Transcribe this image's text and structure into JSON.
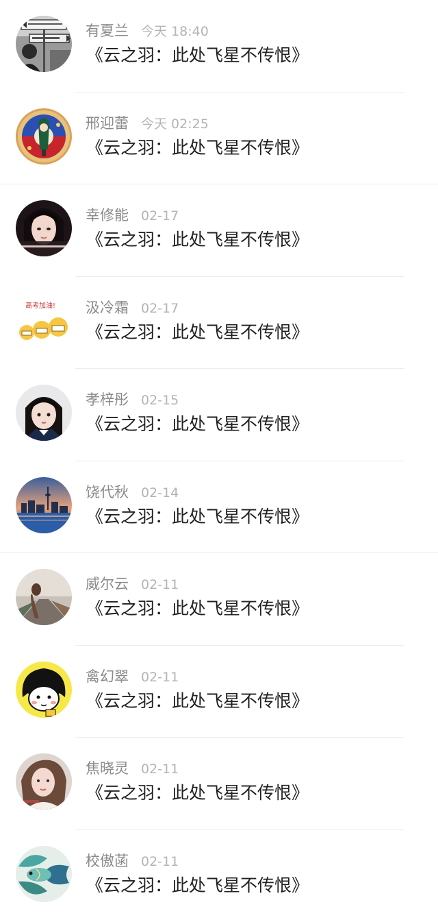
{
  "comments": [
    {
      "name": "有夏兰",
      "time": "今天 18:40",
      "title": "《云之羽：此处飞星不传恨》",
      "avatar_icon": "street-sign-photo-avatar-icon",
      "divider": "inset"
    },
    {
      "name": "邢迎蕾",
      "time": "今天 02:25",
      "title": "《云之羽：此处飞星不传恨》",
      "avatar_icon": "anime-emblem-avatar-icon",
      "divider": "full"
    },
    {
      "name": "幸修能",
      "time": "02-17",
      "title": "《云之羽：此处飞星不传恨》",
      "avatar_icon": "girl-portrait-avatar-icon",
      "divider": "inset"
    },
    {
      "name": "汲冷霜",
      "time": "02-17",
      "title": "《云之羽：此处飞星不传恨》",
      "avatar_icon": "emoji-cheer-avatar-icon",
      "avatar_text": "高考加油!",
      "divider": "inset"
    },
    {
      "name": "孝梓彤",
      "time": "02-15",
      "title": "《云之羽：此处飞星不传恨》",
      "avatar_icon": "child-portrait-avatar-icon",
      "divider": "inset"
    },
    {
      "name": "饶代秋",
      "time": "02-14",
      "title": "《云之羽：此处飞星不传恨》",
      "avatar_icon": "city-skyline-avatar-icon",
      "divider": "full"
    },
    {
      "name": "威尔云",
      "time": "02-11",
      "title": "《云之羽：此处飞星不传恨》",
      "avatar_icon": "rainy-street-avatar-icon",
      "divider": "inset"
    },
    {
      "name": "禽幻翠",
      "time": "02-11",
      "title": "《云之羽：此处飞星不传恨》",
      "avatar_icon": "cartoon-girl-avatar-icon",
      "divider": "inset"
    },
    {
      "name": "焦晓灵",
      "time": "02-11",
      "title": "《云之羽：此处飞星不传恨》",
      "avatar_icon": "woman-portrait-avatar-icon",
      "divider": "inset"
    },
    {
      "name": "校傲菡",
      "time": "02-11",
      "title": "《云之羽：此处飞星不传恨》",
      "avatar_icon": "betta-fish-avatar-icon",
      "divider": "none"
    }
  ],
  "colors": {
    "name_text": "#8a8a8a",
    "time_text": "#b4b4b4",
    "title_text": "#222222",
    "divider": "#ececec",
    "background": "#ffffff"
  }
}
